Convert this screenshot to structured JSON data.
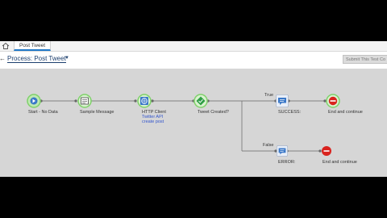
{
  "tab": {
    "label": "Post Tweet"
  },
  "toolbar": {
    "title": "Process: Post Tweet",
    "submit_label": "Submit This Test Co"
  },
  "nodes": {
    "start": {
      "label": "Start - No Data"
    },
    "sample": {
      "label": "Sample Message"
    },
    "http": {
      "label": "HTTP Client",
      "sub1": "Twitter API",
      "sub2": "create post"
    },
    "decision": {
      "label": "Tweet Created?"
    },
    "success": {
      "label": "SUCCESS:"
    },
    "end_true": {
      "label": "End and continue"
    },
    "error": {
      "label": "ERROR:"
    },
    "end_false": {
      "label": "End and continue"
    }
  },
  "branches": {
    "true_label": "True",
    "false_label": "False"
  },
  "colors": {
    "accent": "#1f78c8",
    "start_ring": "#7fd16a",
    "end_red": "#d9231e",
    "msg_blue": "#3a78c8"
  }
}
